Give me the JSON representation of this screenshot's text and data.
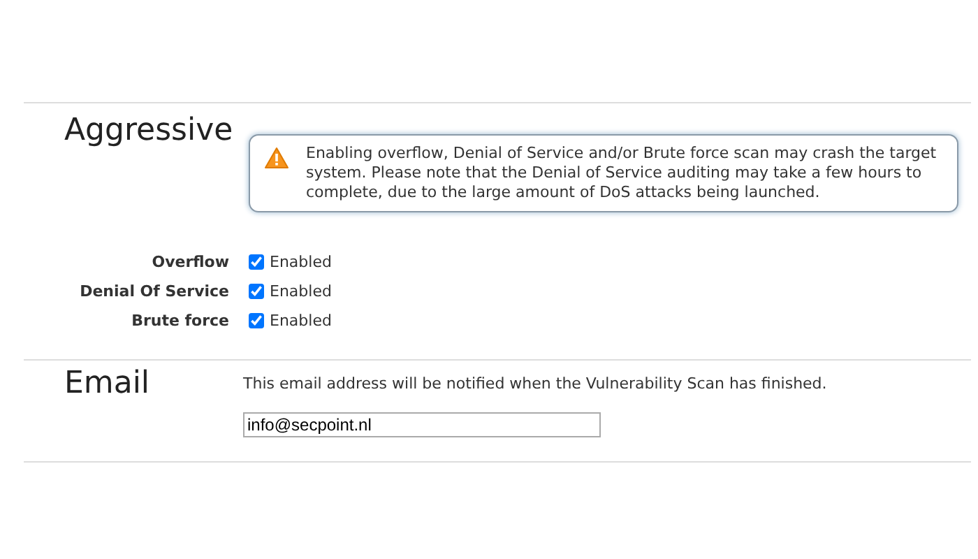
{
  "aggressive": {
    "heading": "Aggressive",
    "warning": "Enabling overflow, Denial of Service and/or Brute force scan may crash the target system. Please note that the Denial of Service auditing may take a few hours to complete, due to the large amount of DoS attacks being launched.",
    "options": [
      {
        "label": "Overflow",
        "text": "Enabled",
        "checked": true
      },
      {
        "label": "Denial Of Service",
        "text": "Enabled",
        "checked": true
      },
      {
        "label": "Brute force",
        "text": "Enabled",
        "checked": true
      }
    ]
  },
  "email": {
    "heading": "Email",
    "note": "This email address will be notified when the Vulnerability Scan has finished.",
    "value": "info@secpoint.nl"
  }
}
